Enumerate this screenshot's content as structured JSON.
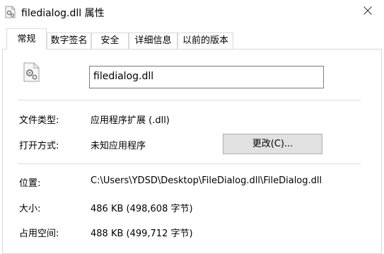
{
  "window": {
    "title": "filedialog.dll 属性"
  },
  "tabs": [
    {
      "label": "常规",
      "active": true
    },
    {
      "label": "数字签名",
      "active": false
    },
    {
      "label": "安全",
      "active": false
    },
    {
      "label": "详细信息",
      "active": false
    },
    {
      "label": "以前的版本",
      "active": false
    }
  ],
  "general": {
    "file_name": "filedialog.dll",
    "file_type_label": "文件类型:",
    "file_type_value": "应用程序扩展 (.dll)",
    "open_with_label": "打开方式:",
    "open_with_value": "未知应用程序",
    "change_button": "更改(C)...",
    "location_label": "位置:",
    "location_value": "C:\\Users\\YDSD\\Desktop\\FileDialog.dll\\FileDialog.dll",
    "size_label": "大小:",
    "size_value": "486 KB (498,608 字节)",
    "size_on_disk_label": "占用空间:",
    "size_on_disk_value": "488 KB (499,712 字节)"
  },
  "icons": {
    "title": "gear-file-icon",
    "file": "gear-file-icon",
    "close": "close-icon"
  }
}
